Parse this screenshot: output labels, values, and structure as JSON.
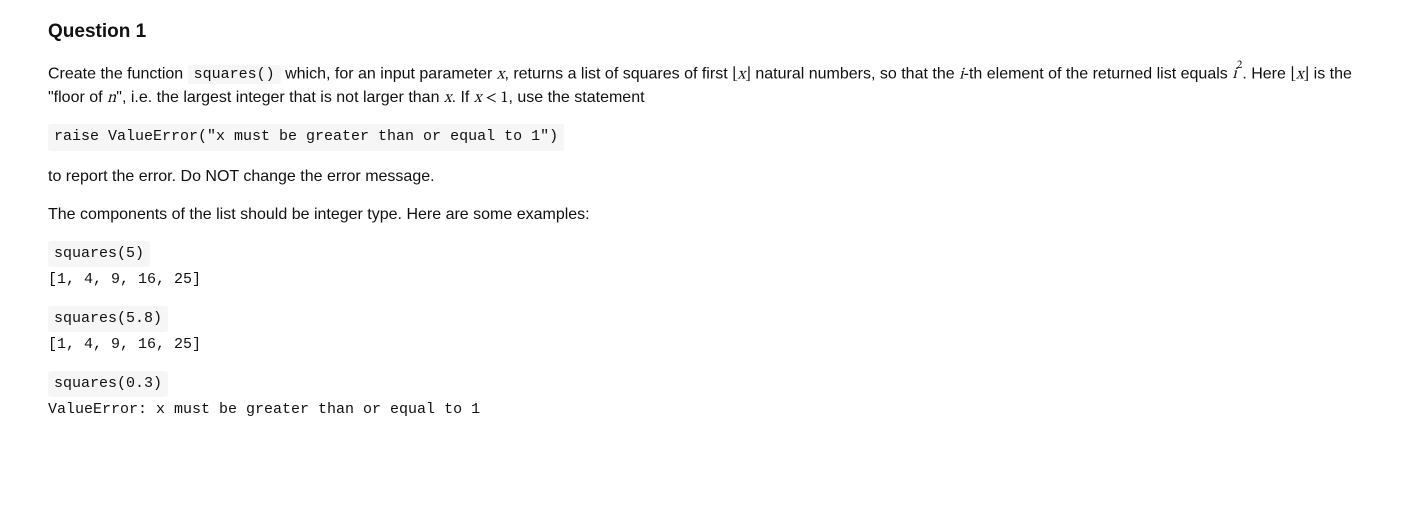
{
  "title": "Question 1",
  "p1": {
    "t1": "Create the function ",
    "code": "squares()",
    "t2": " which, for an input parameter ",
    "x1": "x",
    "t3": ", returns a list of squares of first ",
    "floor1_inner": "x",
    "t4": " natural numbers, so that the ",
    "i1": "i",
    "t5": "-th element of the returned list equals ",
    "i2": "i",
    "exp2": "2",
    "t6": ". Here ",
    "floor2_inner": "x",
    "t7": " is the \"floor of ",
    "n1": "n",
    "t8": "\", i.e. the largest integer that is not larger than ",
    "x2": "x",
    "t9": ". If ",
    "x3": "x",
    "lt": " < ",
    "one": "1",
    "t10": ", use the statement"
  },
  "raise_code": "raise ValueError(\"x must be greater than or equal to 1\")",
  "p2": "to report the error. Do NOT change the error message.",
  "p3": "The components of the list should be integer type. Here are some examples:",
  "examples": [
    {
      "call": "squares(5)",
      "result": "[1, 4, 9, 16, 25]"
    },
    {
      "call": "squares(5.8)",
      "result": "[1, 4, 9, 16, 25]"
    },
    {
      "call": "squares(0.3)",
      "result": "ValueError: x must be greater than or equal to 1"
    }
  ]
}
